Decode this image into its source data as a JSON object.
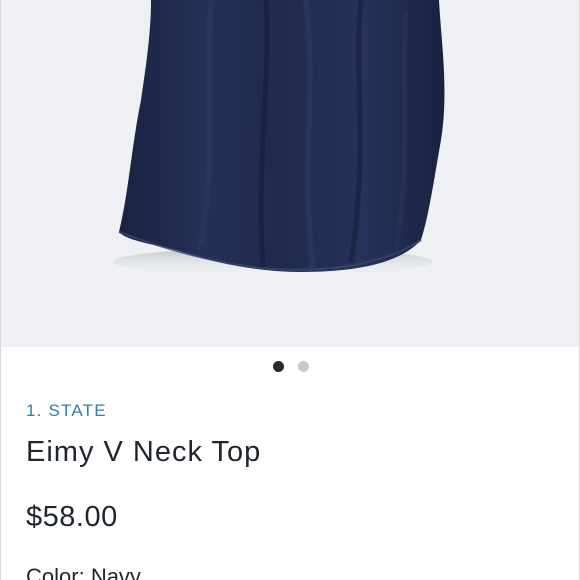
{
  "product_image": {
    "icon": "navy-top-photo",
    "background_color": "#eef0f3",
    "garment_color": "#1f2a47"
  },
  "carousel": {
    "total": 2,
    "active_index": 0
  },
  "product": {
    "brand": "1. STATE",
    "name": "Eimy V Neck Top",
    "price": "$58.00",
    "color_label": "Color:",
    "color_value": "Navy"
  },
  "colors": {
    "brand_accent": "#2f7fa0",
    "text": "#1f262d",
    "dot_active": "#242a31",
    "dot_inactive": "#c8c8c8"
  }
}
